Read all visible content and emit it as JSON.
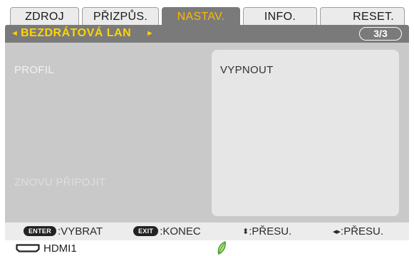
{
  "tabs": [
    {
      "label": "ZDROJ"
    },
    {
      "label": "PŘIZPŮS."
    },
    {
      "label": "NASTAV.",
      "active": true
    },
    {
      "label": "INFO."
    },
    {
      "label": "RESET."
    }
  ],
  "subheader": {
    "title": "BEZDRÁTOVÁ LAN",
    "left_arrow": "◄",
    "right_arrow": "►",
    "page": "3/3"
  },
  "settings": {
    "profile_label": "PROFIL",
    "profile_value": "VYPNOUT",
    "reconnect_label": "ZNOVU PŘIPOJIT"
  },
  "help": {
    "enter_key": "ENTER",
    "enter_action": ":VYBRAT",
    "exit_key": "EXIT",
    "exit_action": ":KONEC",
    "updown_glyph": "⬍",
    "updown_action": ":PŘESU.",
    "leftright_glyph": "◂▸",
    "leftright_action": ":PŘESU."
  },
  "status": {
    "source": "HDMI1",
    "source_icon": "hdmi-icon",
    "eco_icon": "leaf-icon"
  },
  "colors": {
    "active_tab_bg": "#7a7a7a",
    "active_tab_text": "#ffb800",
    "subheader_title": "#ffd400",
    "eco_leaf": "#3a9a2a"
  }
}
